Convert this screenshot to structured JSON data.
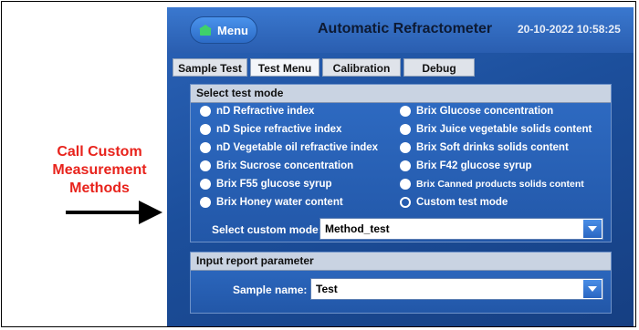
{
  "annotation": {
    "lines": [
      "Call Custom",
      "Measurement",
      "Methods"
    ]
  },
  "header": {
    "menu_label": "Menu",
    "title": "Automatic Refractometer",
    "datetime": "20-10-2022 10:58:25"
  },
  "tabs": [
    {
      "label": "Sample Test"
    },
    {
      "label": "Test Menu"
    },
    {
      "label": "Calibration"
    },
    {
      "label": "Debug"
    }
  ],
  "test_mode": {
    "title": "Select test mode",
    "left": [
      "nD Refractive index",
      "nD Spice refractive index",
      "nD Vegetable oil refractive index",
      "Brix Sucrose concentration",
      "Brix F55 glucose syrup",
      "Brix Honey water content"
    ],
    "right": [
      "Brix Glucose concentration",
      "Brix Juice vegetable solids content",
      "Brix Soft drinks solids content",
      "Brix F42 glucose syrup",
      "Brix Canned products solids content",
      "Custom test mode"
    ],
    "selected": "Custom test mode",
    "custom_label": "Select custom mode:",
    "custom_value": "Method_test"
  },
  "report": {
    "title": "Input report parameter",
    "sample_label": "Sample name:",
    "sample_value": "Test"
  },
  "colors": {
    "annotation": "#e8231c",
    "screen_bg": "#1c4f9c",
    "dropdown": "#2a66c2"
  }
}
